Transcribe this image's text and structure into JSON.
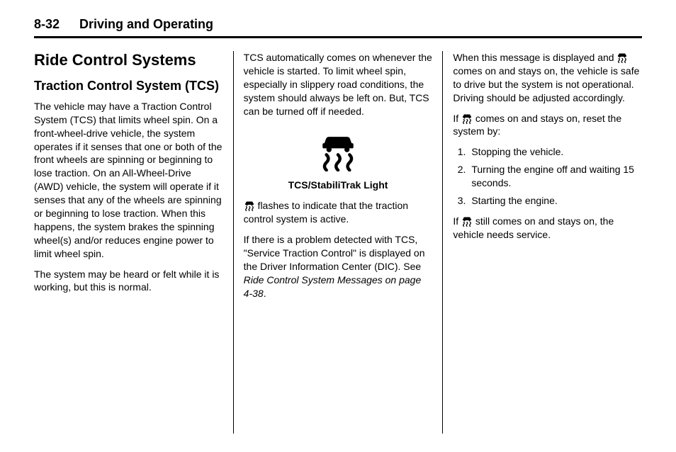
{
  "header": {
    "page_number": "8-32",
    "chapter_title": "Driving and Operating"
  },
  "col1": {
    "section_title": "Ride Control Systems",
    "subsection_title": "Traction Control System (TCS)",
    "p1": "The vehicle may have a Traction Control System (TCS) that limits wheel spin. On a front-wheel-drive vehicle, the system operates if it senses that one or both of the front wheels are spinning or beginning to lose traction. On an All-Wheel-Drive (AWD) vehicle, the system will operate if it senses that any of the wheels are spinning or beginning to lose traction. When this happens, the system brakes the spinning wheel(s) and/or reduces engine power to limit wheel spin.",
    "p2": "The system may be heard or felt while it is working, but this is normal."
  },
  "col2": {
    "p1": "TCS automatically comes on whenever the vehicle is started. To limit wheel spin, especially in slippery road conditions, the system should always be left on. But, TCS can be turned off if needed.",
    "light_caption": "TCS/StabiliTrak Light",
    "p2_after_icon": " flashes to indicate that the traction control system is active.",
    "p3_pre": "If there is a problem detected with TCS, \"Service Traction Control\" is displayed on the Driver Information Center (DIC). See ",
    "p3_ref": "Ride Control System Messages on page 4-38",
    "p3_post": "."
  },
  "col3": {
    "p1_pre": "When this message is displayed and ",
    "p1_post": " comes on and stays on, the vehicle is safe to drive but the system is not operational. Driving should be adjusted accordingly.",
    "p2_pre": "If ",
    "p2_post": " comes on and stays on, reset the system by:",
    "steps": [
      "Stopping the vehicle.",
      "Turning the engine off and waiting 15 seconds.",
      "Starting the engine."
    ],
    "p3_pre": "If ",
    "p3_post": " still comes on and stays on, the vehicle needs service."
  }
}
